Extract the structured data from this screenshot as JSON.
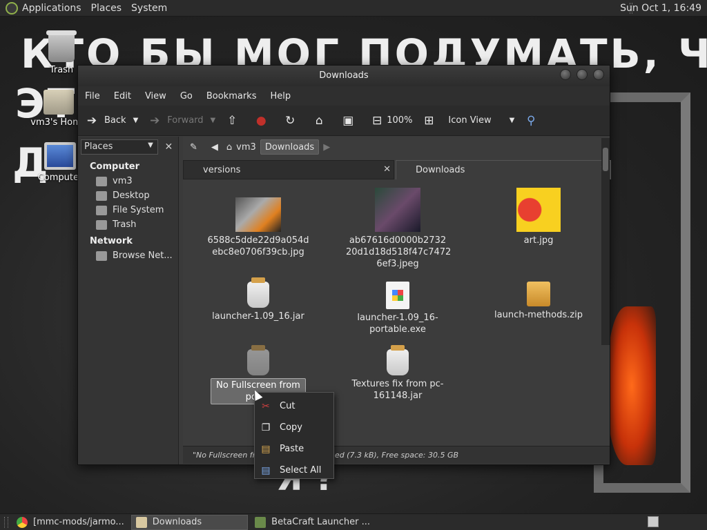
{
  "top_panel": {
    "menus": [
      "Applications",
      "Places",
      "System"
    ],
    "clock": "Sun Oct 1, 16:49"
  },
  "wallpaper": {
    "text_top": "КТО БЫ МОГ ПОДУМАТЬ, ЧТО Я -",
    "text_left_1": "ЭТ",
    "text_left_2": "Д",
    "text_bottom": "Я ?"
  },
  "desktop": {
    "trash": "Trash",
    "home": "vm3's Home",
    "computer": "Computer"
  },
  "window": {
    "title": "Downloads",
    "menu": [
      "File",
      "Edit",
      "View",
      "Go",
      "Bookmarks",
      "Help"
    ],
    "toolbar": {
      "back": "Back",
      "forward": "Forward",
      "zoom": "100%",
      "view_mode": "Icon View"
    },
    "sidebar": {
      "combo": "Places",
      "computer_header": "Computer",
      "computer_items": [
        "vm3",
        "Desktop",
        "File System",
        "Trash"
      ],
      "network_header": "Network",
      "network_items": [
        "Browse Net..."
      ]
    },
    "path": [
      "vm3",
      "Downloads"
    ],
    "tabs": [
      "versions",
      "Downloads"
    ],
    "files": [
      {
        "name": "6588c5dde22d9a054d\nebc8e0706f39cb.jpg",
        "kind": "thumb-cats"
      },
      {
        "name": "ab67616d0000b2732\n20d1d18d518f47c7472\n6ef3.jpeg",
        "kind": "thumb-band"
      },
      {
        "name": "art.jpg",
        "kind": "thumb-art"
      },
      {
        "name": "launcher-1.09_16.jar",
        "kind": "jar"
      },
      {
        "name": "launcher-1.09_16-\nportable.exe",
        "kind": "exe"
      },
      {
        "name": "launch-methods.zip",
        "kind": "zip"
      },
      {
        "name": "No Fullscreen from\npc-15",
        "kind": "jar"
      },
      {
        "name": "Textures fix from pc-\n161148.jar",
        "kind": "jar"
      }
    ],
    "status": "\"No Fullscreen fro",
    "status_tail": "ed (7.3 kB), Free space: 30.5 GB"
  },
  "context_menu": [
    "Cut",
    "Copy",
    "Paste",
    "Select All"
  ],
  "taskbar": {
    "tasks": [
      "[mmc-mods/jarmo...",
      "Downloads",
      "BetaCraft Launcher ..."
    ]
  },
  "colors": {
    "panel": "#2b2b2b",
    "window_bg": "#3c3c3c",
    "stop_red": "#c0302a",
    "fire_orange": "#ff6a1a"
  }
}
